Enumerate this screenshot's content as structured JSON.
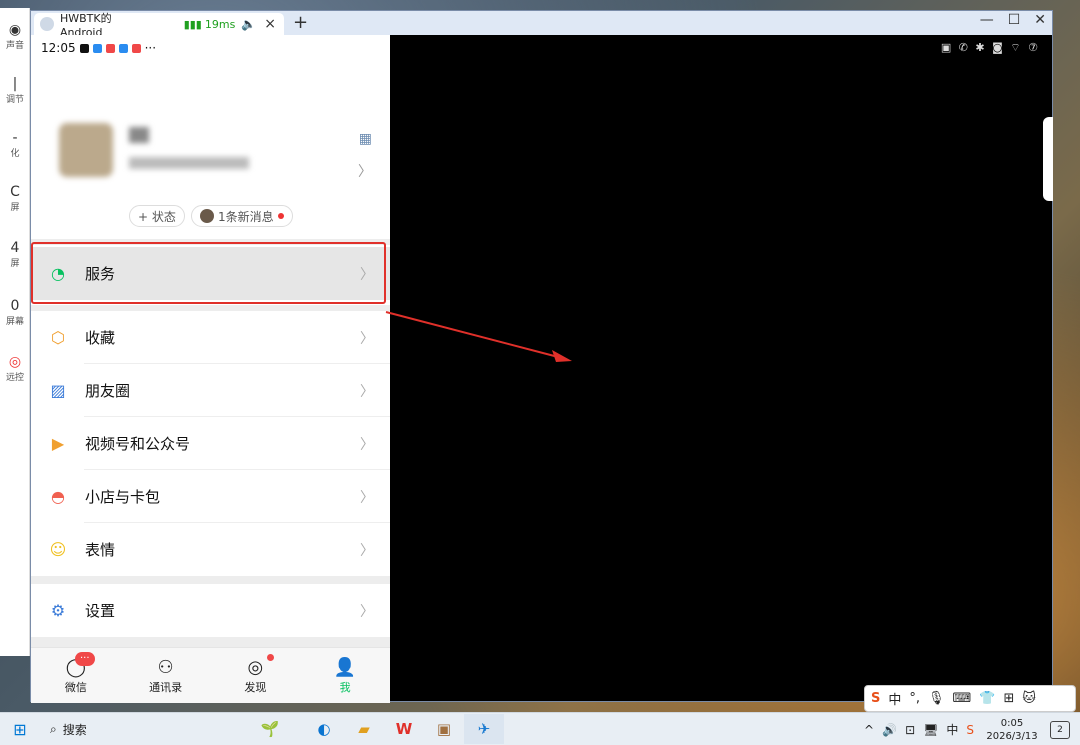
{
  "side_panel": {
    "items": [
      {
        "icon": "◉",
        "label": "声音"
      },
      {
        "icon": "|",
        "label": "调节"
      },
      {
        "icon": "-",
        "label": "化"
      },
      {
        "icon": "C",
        "label": "屏"
      },
      {
        "icon": "4",
        "label": "屏"
      },
      {
        "icon": "0",
        "label": "屏幕"
      },
      {
        "icon": "◎",
        "label": "远控"
      }
    ]
  },
  "window": {
    "tab_title": "HWBTK的Android",
    "latency": "19ms",
    "new_tab": "+",
    "tab_close": "×",
    "controls": [
      "—",
      "☐",
      "✕"
    ]
  },
  "phone": {
    "status_time": "12:05",
    "status_more": "···",
    "status_right": "▣ ✆ ✱ ◙ ⌔ ⑦",
    "profile": {
      "status_chip": "+ 状态",
      "message_chip": "1条新消息"
    },
    "menu": [
      {
        "label": "服务",
        "icon": "service-icon",
        "glyph": "◔",
        "color": "#07c160"
      },
      {
        "label": "收藏",
        "icon": "favorites-icon",
        "glyph": "⬡",
        "color": "#f0a030"
      },
      {
        "label": "朋友圈",
        "icon": "moments-icon",
        "glyph": "▨",
        "color": "#3b7bd8"
      },
      {
        "label": "视频号和公众号",
        "icon": "channels-icon",
        "glyph": "▶",
        "color": "#f0a030"
      },
      {
        "label": "小店与卡包",
        "icon": "shop-icon",
        "glyph": "◓",
        "color": "#f06050"
      },
      {
        "label": "表情",
        "icon": "emoji-icon",
        "glyph": "☺",
        "color": "#f0c020"
      },
      {
        "label": "设置",
        "icon": "settings-icon",
        "glyph": "⚙",
        "color": "#3b7bd8"
      }
    ],
    "tabs": [
      {
        "label": "微信",
        "glyph": "◯",
        "badge": "···"
      },
      {
        "label": "通讯录",
        "glyph": "⚇"
      },
      {
        "label": "发现",
        "glyph": "◎"
      },
      {
        "label": "我",
        "glyph": "👤"
      }
    ]
  },
  "ime_bar": [
    "S",
    "中",
    "°,",
    "🎙",
    "⌨",
    "👕",
    "⊞",
    "🐱"
  ],
  "taskbar": {
    "search_label": "搜索",
    "time": "0:05",
    "date": "2026/3/13",
    "notif_count": "2",
    "tray": [
      "^",
      "🔊",
      "⊡",
      "🖥",
      "中",
      "S"
    ]
  },
  "colors": {
    "accent": "#07c160",
    "highlight": "#e0302a",
    "badge": "#f04848"
  }
}
